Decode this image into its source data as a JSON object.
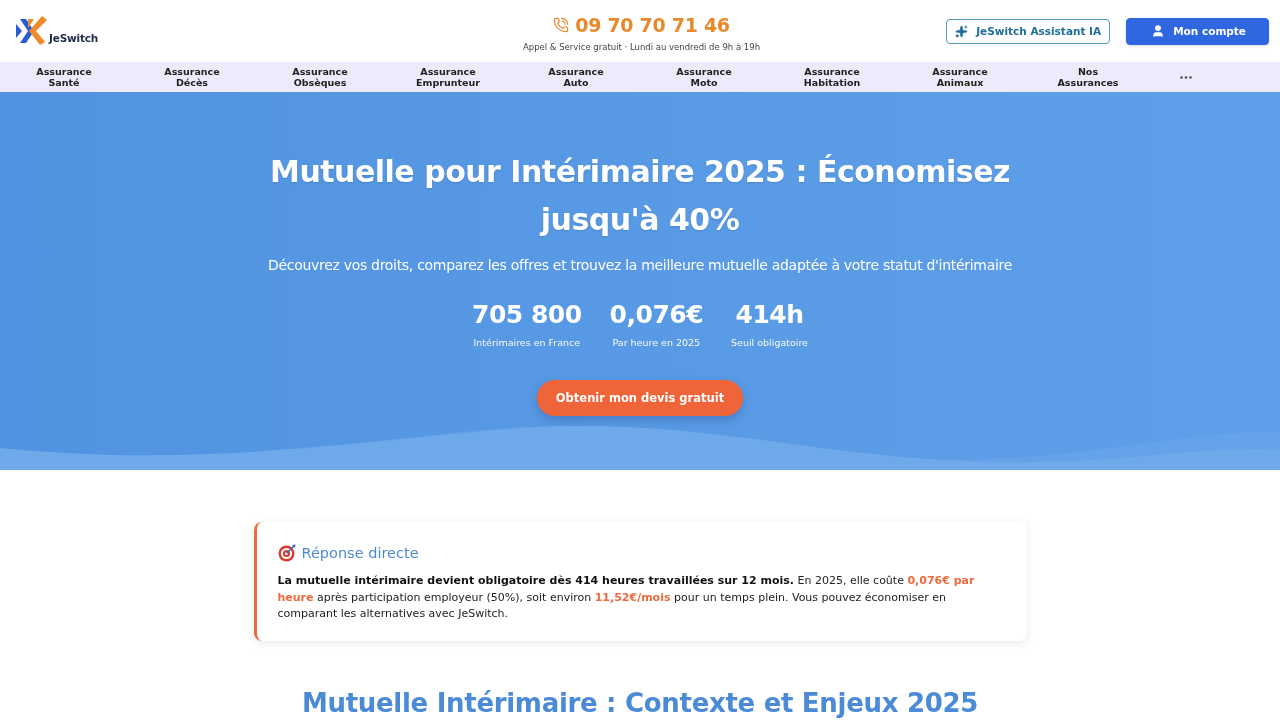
{
  "header": {
    "logo": {
      "text": "JeSwitch"
    },
    "phone": "09 70 70 71 46",
    "hours": "Appel & Service gratuit · Lundi au vendredi de 9h à 19h",
    "buttons": [
      {
        "kind": "assistant",
        "label": "JeSwitch Assistant IA"
      },
      {
        "kind": "account",
        "label": "Mon compte"
      }
    ]
  },
  "nav": {
    "items": [
      "Assurance Santé",
      "Assurance Décès",
      "Assurance Obsèques",
      "Assurance Emprunteur",
      "Assurance Auto",
      "Assurance Moto",
      "Assurance Habitation",
      "Assurance Animaux",
      "Nos Assurances"
    ]
  },
  "hero": {
    "title": "Mutuelle pour Intérimaire 2025 : Économisez jusqu'à 40%",
    "subtitle": "Découvrez vos droits, comparez les offres et trouvez la meilleure mutuelle adaptée à votre statut d'intérimaire",
    "stats": [
      {
        "value": "705 800",
        "label": "Intérimaires en France"
      },
      {
        "value": "0,076€",
        "label": "Par heure en 2025"
      },
      {
        "value": "414h",
        "label": "Seuil obligatoire"
      }
    ],
    "cta": "Obtenir mon devis gratuit"
  },
  "answer_card": {
    "title": "Réponse directe",
    "segments": [
      {
        "kind": "strong",
        "text": "La mutuelle intérimaire devient obligatoire dès 414 heures travaillées sur 12 mois."
      },
      {
        "kind": "plain",
        "text": " En 2025, elle coûte "
      },
      {
        "kind": "highlight",
        "text": "0,076€ par heure"
      },
      {
        "kind": "plain",
        "text": " après participation employeur (50%), soit environ "
      },
      {
        "kind": "highlight",
        "text": "11,52€/mois"
      },
      {
        "kind": "plain",
        "text": " pour un temps plein. Vous pouvez économiser en comparant les alternatives avec JeSwitch."
      }
    ]
  },
  "section": {
    "heading": "Mutuelle Intérimaire : Contexte et Enjeux 2025"
  }
}
